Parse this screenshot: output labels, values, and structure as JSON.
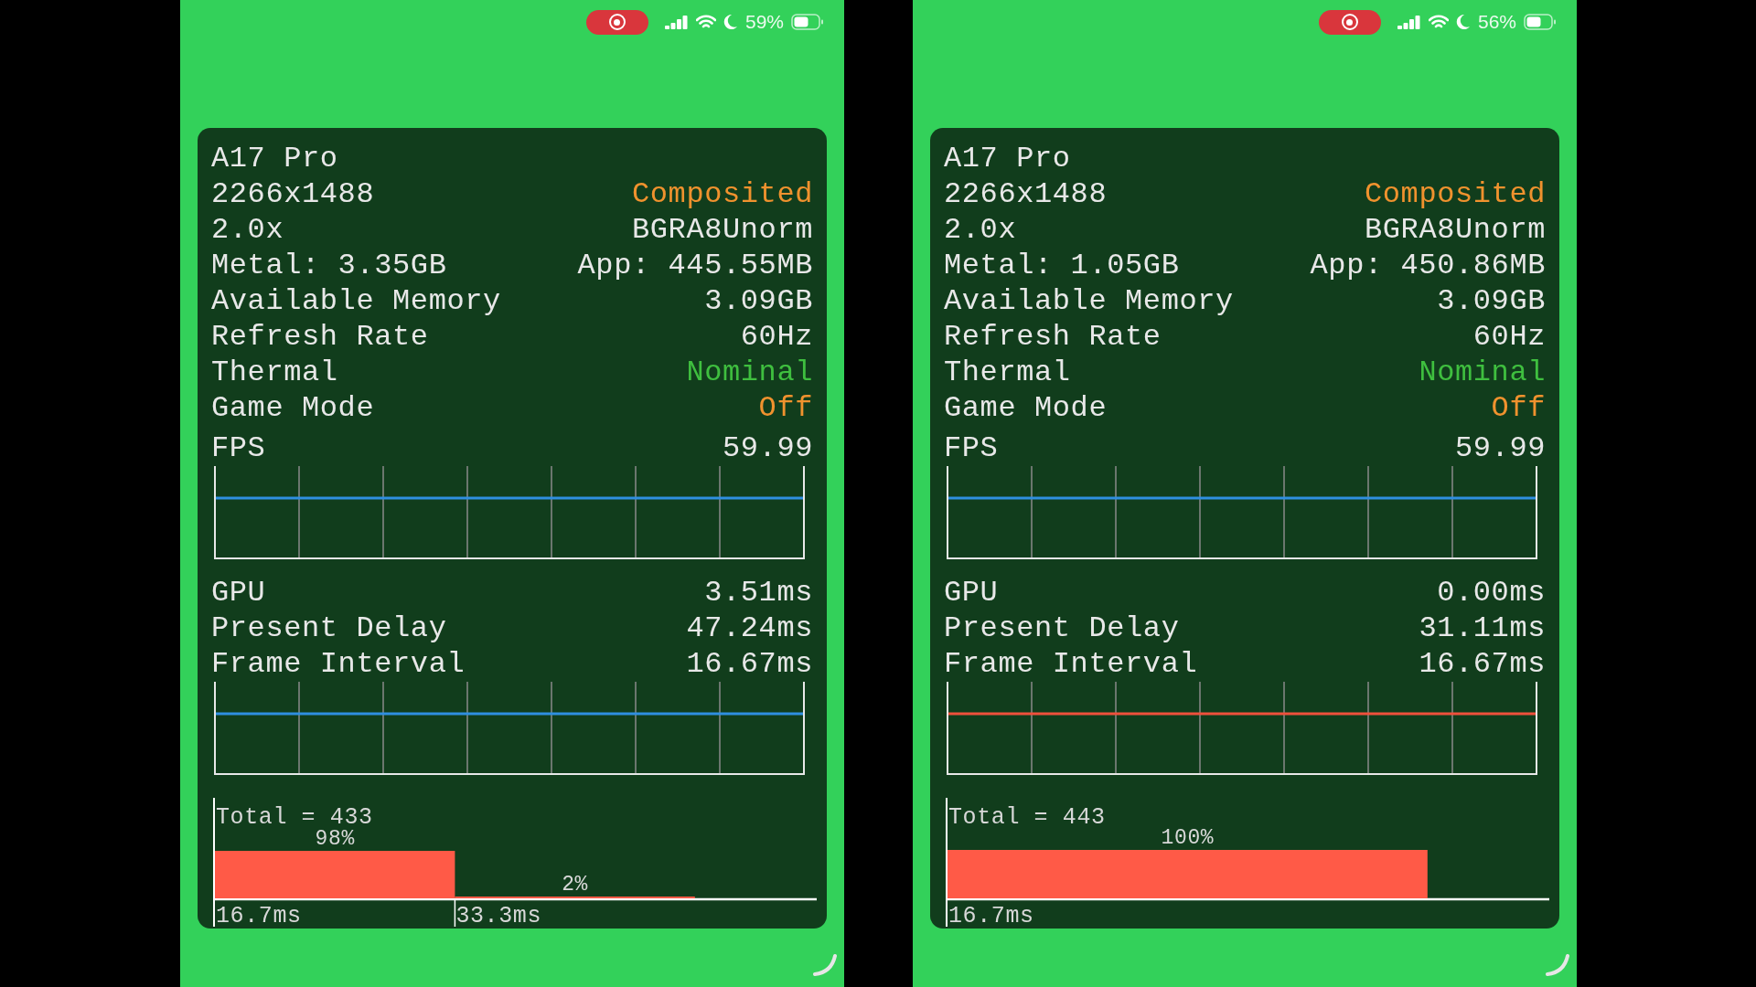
{
  "phones": [
    {
      "status_bar": {
        "recording": true,
        "battery_text": "59%"
      },
      "info_rows": [
        {
          "label": "A17 Pro",
          "kind": "plain"
        },
        {
          "label": "2266x1488",
          "value": "Composited",
          "kind": "warning"
        },
        {
          "label": "2.0x",
          "value": "BGRA8Unorm",
          "kind": "plain"
        },
        {
          "label": "Metal: 3.35GB",
          "value": "App: 445.55MB",
          "kind": "plain"
        },
        {
          "label": "Available Memory",
          "value": "3.09GB",
          "kind": "plain"
        },
        {
          "label": "Refresh Rate",
          "value": "60Hz",
          "kind": "plain"
        },
        {
          "label": "Thermal",
          "value": "Nominal",
          "kind": "good"
        },
        {
          "label": "Game Mode",
          "value": "Off",
          "kind": "warning"
        }
      ],
      "fps": {
        "label": "FPS",
        "value": "59.99",
        "color": "#2f8fe0"
      },
      "timing_rows": [
        {
          "label": "GPU",
          "value": "3.51ms"
        },
        {
          "label": "Present Delay",
          "value": "47.24ms"
        },
        {
          "label": "Frame Interval",
          "value": "16.67ms"
        }
      ],
      "frame_graph": {
        "color": "#2f8fe0"
      },
      "histogram": {
        "chart_data": {
          "type": "bar",
          "title": "Total = 433",
          "categories": [
            "16.7ms",
            "33.3ms"
          ],
          "values": [
            98,
            2
          ],
          "ylim": [
            0,
            100
          ],
          "value_labels": [
            "98%",
            "2%"
          ]
        }
      }
    },
    {
      "status_bar": {
        "recording": true,
        "battery_text": "56%"
      },
      "info_rows": [
        {
          "label": "A17 Pro",
          "kind": "plain"
        },
        {
          "label": "2266x1488",
          "value": "Composited",
          "kind": "warning"
        },
        {
          "label": "2.0x",
          "value": "BGRA8Unorm",
          "kind": "plain"
        },
        {
          "label": "Metal: 1.05GB",
          "value": "App: 450.86MB",
          "kind": "plain"
        },
        {
          "label": "Available Memory",
          "value": "3.09GB",
          "kind": "plain"
        },
        {
          "label": "Refresh Rate",
          "value": "60Hz",
          "kind": "plain"
        },
        {
          "label": "Thermal",
          "value": "Nominal",
          "kind": "good"
        },
        {
          "label": "Game Mode",
          "value": "Off",
          "kind": "warning"
        }
      ],
      "fps": {
        "label": "FPS",
        "value": "59.99",
        "color": "#2f8fe0"
      },
      "timing_rows": [
        {
          "label": "GPU",
          "value": "0.00ms"
        },
        {
          "label": "Present Delay",
          "value": "31.11ms"
        },
        {
          "label": "Frame Interval",
          "value": "16.67ms"
        }
      ],
      "frame_graph": {
        "color": "#f0503c"
      },
      "histogram": {
        "title": "Total = 443",
        "bars": [
          {
            "label": "100%",
            "bucket": "16.7ms"
          }
        ]
      }
    }
  ]
}
